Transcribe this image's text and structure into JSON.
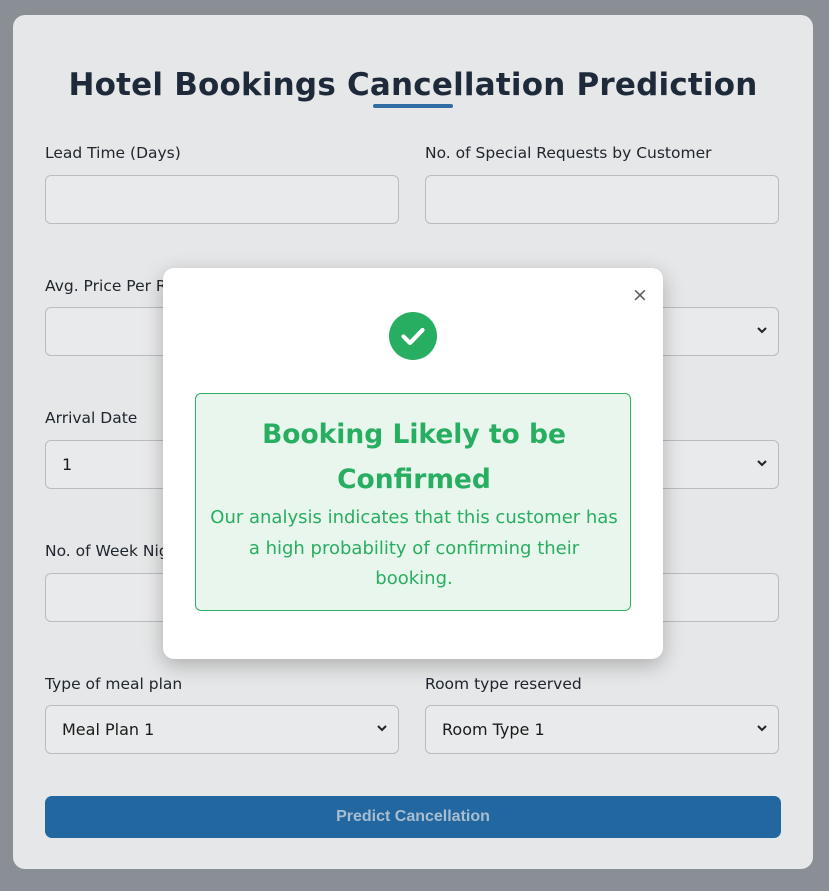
{
  "page": {
    "title": "Hotel Bookings Cancellation Prediction"
  },
  "form": {
    "lead_time": {
      "label": "Lead Time (Days)",
      "value": ""
    },
    "special_requests": {
      "label": "No. of Special Requests by Customer",
      "value": ""
    },
    "avg_price": {
      "label": "Avg. Price Per R",
      "value": ""
    },
    "arrival_date": {
      "label": "Arrival Date",
      "value": "1"
    },
    "week_nights": {
      "label": "No. of Week Nig",
      "value": ""
    },
    "meal_plan": {
      "label": "Type of meal plan",
      "value": "Meal Plan 1"
    },
    "room_type": {
      "label": "Room type reserved",
      "value": "Room Type 1"
    },
    "predict_button": "Predict Cancellation"
  },
  "modal": {
    "close_label": "×",
    "result_title": "Booking Likely to be Confirmed",
    "result_text": "Our analysis indicates that this customer has a high probability of confirming their booking."
  },
  "icons": {
    "success": "check-circle-icon",
    "close": "close-icon",
    "dropdown": "chevron-down-icon"
  },
  "colors": {
    "accent": "#2f6ea2",
    "button": "#22679f",
    "success": "#27ae60",
    "success_bg": "#e9f6ee"
  }
}
